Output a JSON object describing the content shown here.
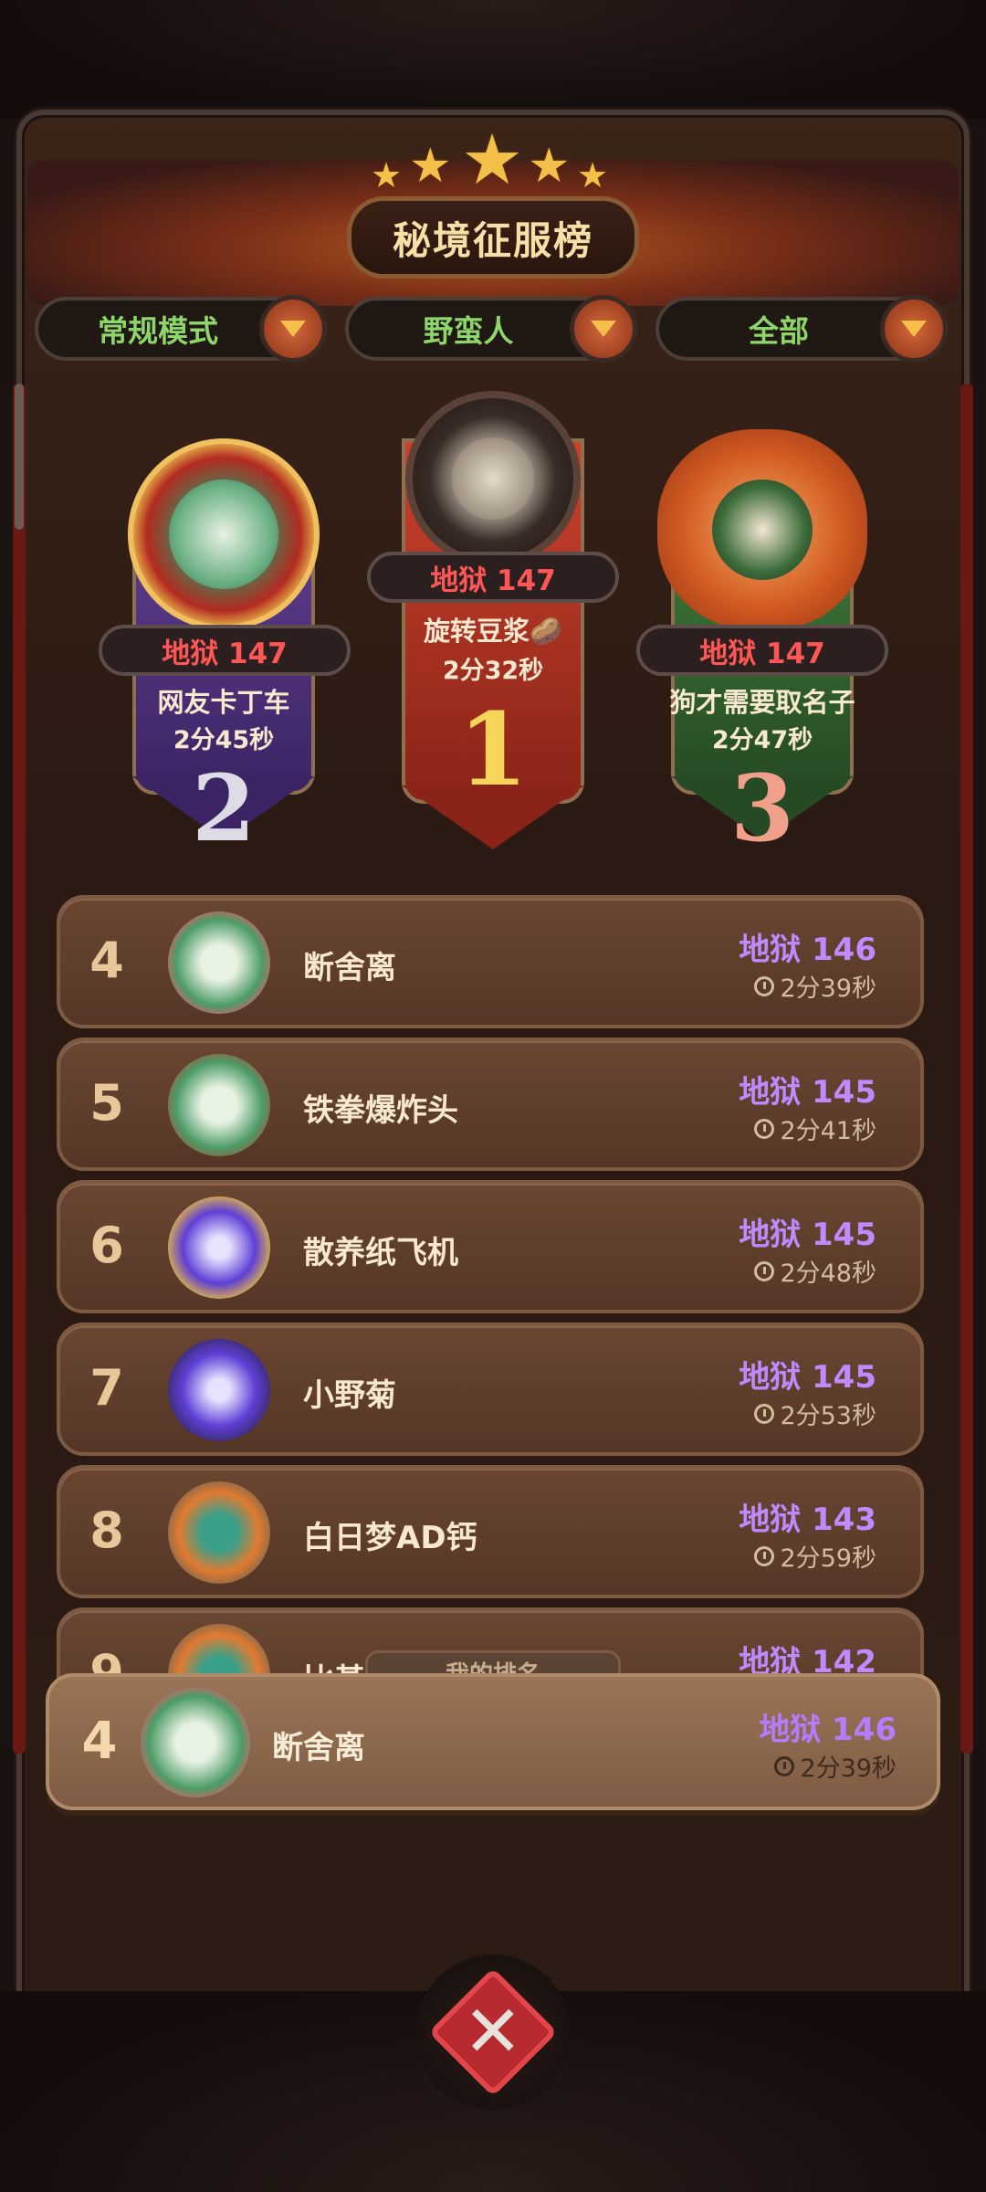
{
  "title": "秘境征服榜",
  "filters": [
    {
      "label": "常规模式"
    },
    {
      "label": "野蛮人"
    },
    {
      "label": "全部"
    }
  ],
  "podium": {
    "first": {
      "level": "地狱 147",
      "name": "旋转豆浆🥔",
      "time": "2分32秒",
      "rank": "1"
    },
    "second": {
      "level": "地狱 147",
      "name": "网友卡丁车",
      "time": "2分45秒",
      "rank": "2"
    },
    "third": {
      "level": "地狱 147",
      "name": "狗才需要取名子",
      "time": "2分47秒",
      "rank": "3"
    }
  },
  "ranking": [
    {
      "rank": "4",
      "name": "断舍离",
      "level": "地狱 146",
      "time": "2分39秒"
    },
    {
      "rank": "5",
      "name": "铁拳爆炸头",
      "level": "地狱 145",
      "time": "2分41秒"
    },
    {
      "rank": "6",
      "name": "散养纸飞机",
      "level": "地狱 145",
      "time": "2分48秒"
    },
    {
      "rank": "7",
      "name": "小野菊",
      "level": "地狱 145",
      "time": "2分53秒"
    },
    {
      "rank": "8",
      "name": "白日梦AD钙",
      "level": "地狱 143",
      "time": "2分59秒"
    },
    {
      "rank": "9",
      "name": "比基",
      "level": "地狱 142",
      "time": ""
    }
  ],
  "my_rank": {
    "tag": "我的排名",
    "rank": "4",
    "name": "断舍离",
    "level": "地狱 146",
    "time": "2分39秒"
  },
  "colors": {
    "level_red": "#ff5656",
    "level_purple": "#c089ff",
    "filter_green": "#8fd66a"
  },
  "icons": [
    "star-icon",
    "dropdown-arrow-icon",
    "clock-icon",
    "close-icon"
  ]
}
